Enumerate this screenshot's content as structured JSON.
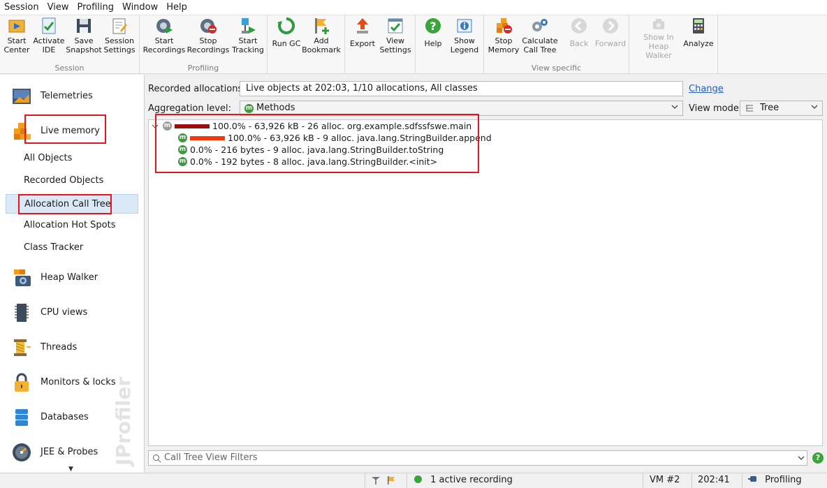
{
  "menu": [
    "Session",
    "View",
    "Profiling",
    "Window",
    "Help"
  ],
  "toolbar": {
    "groups": [
      {
        "label": "Session",
        "buttons": [
          "Start\nCenter",
          "Activate\nIDE",
          "Save\nSnapshot",
          "Session\nSettings"
        ]
      },
      {
        "label": "Profiling",
        "buttons": [
          "Start\nRecordings",
          "Stop\nRecordings",
          "Start\nTracking"
        ]
      },
      {
        "label": "",
        "buttons": [
          "Run GC",
          "Add\nBookmark"
        ]
      },
      {
        "label": "",
        "buttons": [
          "Export",
          "View\nSettings"
        ]
      },
      {
        "label": "",
        "buttons": [
          "Help",
          "Show\nLegend"
        ]
      },
      {
        "label": "View specific",
        "buttons": [
          "Stop\nMemory",
          "Calculate\nCall Tree",
          "Back",
          "Forward"
        ]
      },
      {
        "label": "",
        "buttons": [
          "Show In\nHeap Walker",
          "Analyze"
        ]
      }
    ],
    "disabled": [
      "Back",
      "Forward",
      "Show In\nHeap Walker"
    ]
  },
  "sidebar": {
    "sections": [
      {
        "label": "Telemetries",
        "icon": "telemetries-icon"
      },
      {
        "label": "Live memory",
        "icon": "live-memory-icon"
      },
      {
        "label": "Heap Walker",
        "icon": "heap-walker-icon"
      },
      {
        "label": "CPU views",
        "icon": "cpu-views-icon"
      },
      {
        "label": "Threads",
        "icon": "threads-icon"
      },
      {
        "label": "Monitors & locks",
        "icon": "monitors-locks-icon"
      },
      {
        "label": "Databases",
        "icon": "databases-icon"
      },
      {
        "label": "JEE & Probes",
        "icon": "jee-probes-icon"
      }
    ],
    "live_memory_items": [
      "All Objects",
      "Recorded Objects",
      "Allocation Call Tree",
      "Allocation Hot Spots",
      "Class Tracker"
    ],
    "selected": "Allocation Call Tree",
    "watermark": "JProfiler"
  },
  "main": {
    "recorded_label": "Recorded allocations:",
    "recorded_value": "Live objects at 202:03, 1/10 allocations, All classes",
    "change_link": "Change",
    "aggregation_label": "Aggregation level:",
    "aggregation_value": "Methods",
    "view_mode_label": "View mode:",
    "view_mode_value": "Tree",
    "filter_placeholder": "Call Tree View Filters",
    "tree": [
      {
        "depth": 0,
        "text": "100.0% - 63,926 kB - 26 alloc. org.example.sdfssfswe.main",
        "percent": 100.0,
        "color": "#9a0f0f",
        "expanded": true
      },
      {
        "depth": 1,
        "text": "100.0% - 63,926 kB - 9 alloc. java.lang.StringBuilder.append",
        "percent": 100.0,
        "color": "#f0380c"
      },
      {
        "depth": 1,
        "text": "0.0% - 216 bytes - 9 alloc. java.lang.StringBuilder.toString",
        "percent": 0.0,
        "color": "#f0380c"
      },
      {
        "depth": 1,
        "text": "0.0% - 192 bytes - 8 alloc. java.lang.StringBuilder.<init>",
        "percent": 0.0,
        "color": "#f0380c"
      }
    ]
  },
  "status": {
    "recording": "1 active recording",
    "vm": "VM #2",
    "time": "202:41",
    "mode": "Profiling"
  },
  "colors": {
    "accent_red": "#e8141b",
    "selection": "#dbe9f7",
    "link": "#1f5fc4",
    "method_green": "#3f9a3f"
  }
}
